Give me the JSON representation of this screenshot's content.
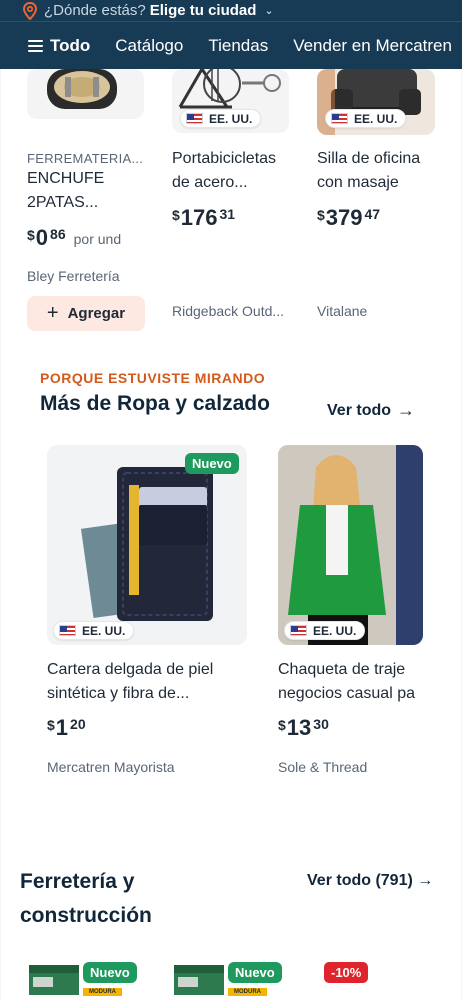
{
  "header": {
    "location_prompt": "¿Dónde estás?",
    "location_cta": "Elige tu ciudad",
    "nav": {
      "menu_label": "Todo",
      "links": [
        "Catálogo",
        "Tiendas",
        "Vender en Mercatren"
      ]
    }
  },
  "top_products": [
    {
      "brand": "FERREMATERIA...",
      "title_line1": "ENCHUFE",
      "title_line2": "2PATAS...",
      "price_currency": "$",
      "price_int": "0",
      "price_dec": "86",
      "price_unit": "por und",
      "seller": "Bley Ferretería",
      "add_label": "Agregar"
    },
    {
      "badge": "EE. UU.",
      "title_line1": "Portabicicletas",
      "title_line2": "de acero...",
      "price_currency": "$",
      "price_int": "176",
      "price_dec": "31",
      "seller": "Ridgeback Outd..."
    },
    {
      "badge": "EE. UU.",
      "title_line1": "Silla de oficina",
      "title_line2": "con masaje",
      "price_currency": "$",
      "price_int": "379",
      "price_dec": "47",
      "seller": "Vitalane"
    }
  ],
  "recommend_section": {
    "eyebrow": "PORQUE ESTUVISTE MIRANDO",
    "title": "Más de Ropa y calzado",
    "see_all": "Ver todo",
    "products": [
      {
        "tag": "Nuevo",
        "badge": "EE. UU.",
        "title_line1": "Cartera delgada de piel",
        "title_line2": "sintética y fibra de...",
        "price_currency": "$",
        "price_int": "1",
        "price_dec": "20",
        "seller": "Mercatren Mayorista"
      },
      {
        "badge": "EE. UU.",
        "title_line1": "Chaqueta de traje",
        "title_line2": "negocios casual pa",
        "price_currency": "$",
        "price_int": "13",
        "price_dec": "30",
        "seller": "Sole & Thread"
      }
    ]
  },
  "hardware_section": {
    "title": "Ferretería y construcción",
    "see_all": "Ver todo (791)",
    "tags": [
      "Nuevo",
      "Nuevo",
      "-10%"
    ],
    "product_brand": "MODURA"
  },
  "colors": {
    "header_bg": "#173a55",
    "accent_orange": "#d35a1c",
    "new_green": "#1f9a5e",
    "discount_red": "#e0242d",
    "add_button_bg": "#fde9e1"
  }
}
